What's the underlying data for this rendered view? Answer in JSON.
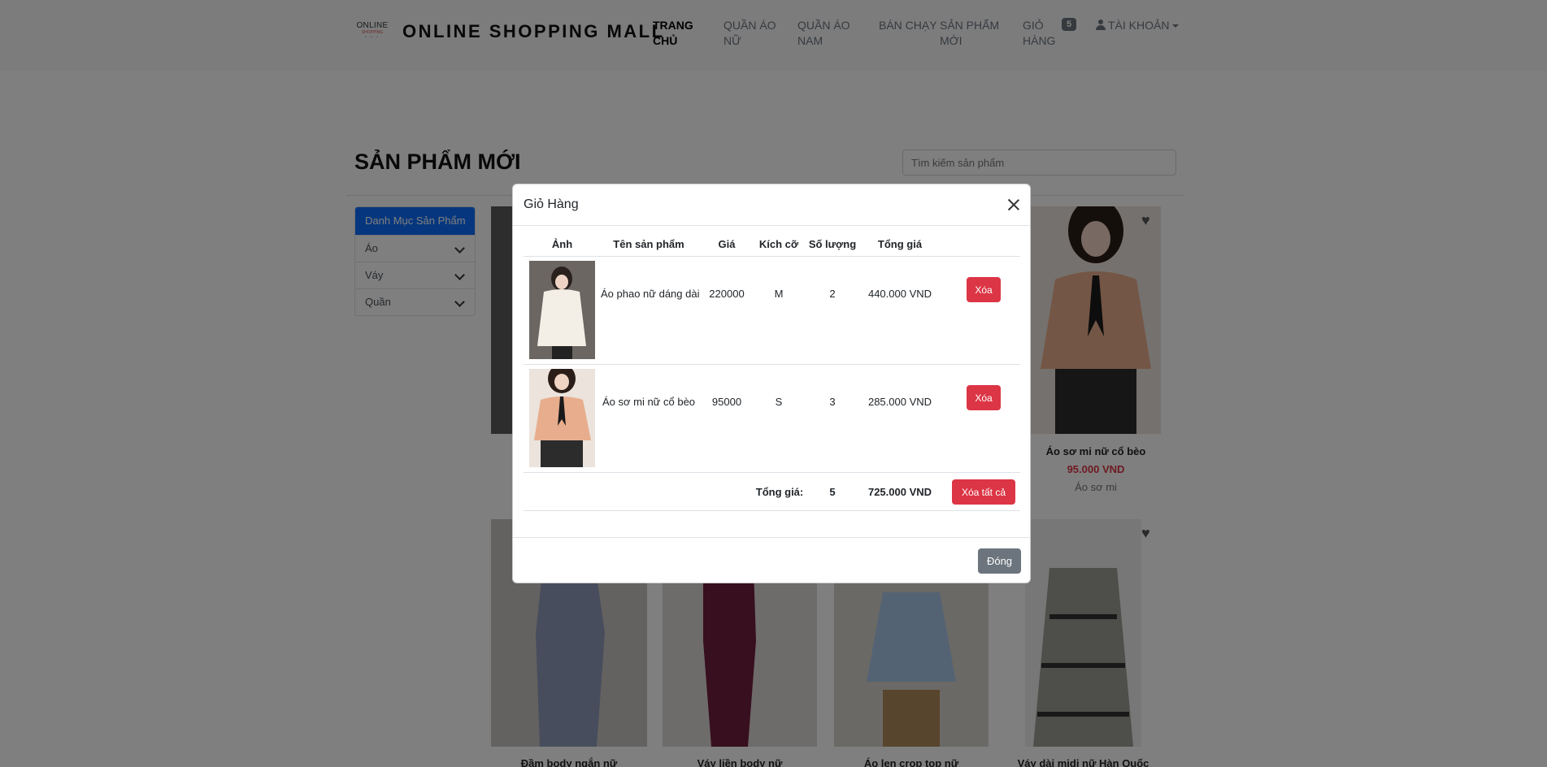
{
  "navbar": {
    "logo_text": "ONLINE",
    "logo_sub": "SHOPPING",
    "logo_dots": "• • •",
    "brand": "ONLINE SHOPPING MALL",
    "items": [
      {
        "label": "TRANG CHỦ"
      },
      {
        "label": "QUẦN ÁO NỮ"
      },
      {
        "label": "QUẦN ÁO NAM"
      },
      {
        "label": "BÁN CHẠY"
      },
      {
        "label": "SẢN PHẨM MỚI"
      },
      {
        "label": "GIỎ HÀNG"
      }
    ],
    "cart_count": "5",
    "account_label": "TÀI KHOẢN"
  },
  "page": {
    "title": "SẢN PHẨM MỚI",
    "search_placeholder": "Tìm kiếm sản phẩm"
  },
  "categories": {
    "header": "Danh Mục Sản Phẩm",
    "items": [
      "Áo",
      "Váy",
      "Quần"
    ]
  },
  "products": {
    "visible_card": {
      "name": "Áo sơ mi nữ cổ bèo",
      "price": "95.000 VND",
      "category": "Áo sơ mi"
    },
    "bottom_names": [
      "Đầm body ngắn nữ",
      "Váy liền body nữ",
      "Áo len crop top nữ",
      "Váy dài midi nữ Hàn Quốc"
    ]
  },
  "modal": {
    "title": "Giỏ Hàng",
    "headers": [
      "Ảnh",
      "Tên sản phẩm",
      "Giá",
      "Kích cỡ",
      "Số lượng",
      "Tổng giá"
    ],
    "rows": [
      {
        "name": "Áo phao nữ dáng dài",
        "price": "220000",
        "size": "M",
        "qty": "2",
        "total": "440.000 VND",
        "delete_label": "Xóa"
      },
      {
        "name": "Áo sơ mi nữ cổ bèo",
        "price": "95000",
        "size": "S",
        "qty": "3",
        "total": "285.000 VND",
        "delete_label": "Xóa"
      }
    ],
    "summary": {
      "label": "Tổng giá:",
      "qty": "5",
      "total": "725.000 VND",
      "clear_label": "Xóa tất cả"
    },
    "close_label": "Đóng"
  },
  "colors": {
    "primary": "#0d6efd",
    "danger": "#dc3545",
    "secondary": "#6c757d"
  }
}
